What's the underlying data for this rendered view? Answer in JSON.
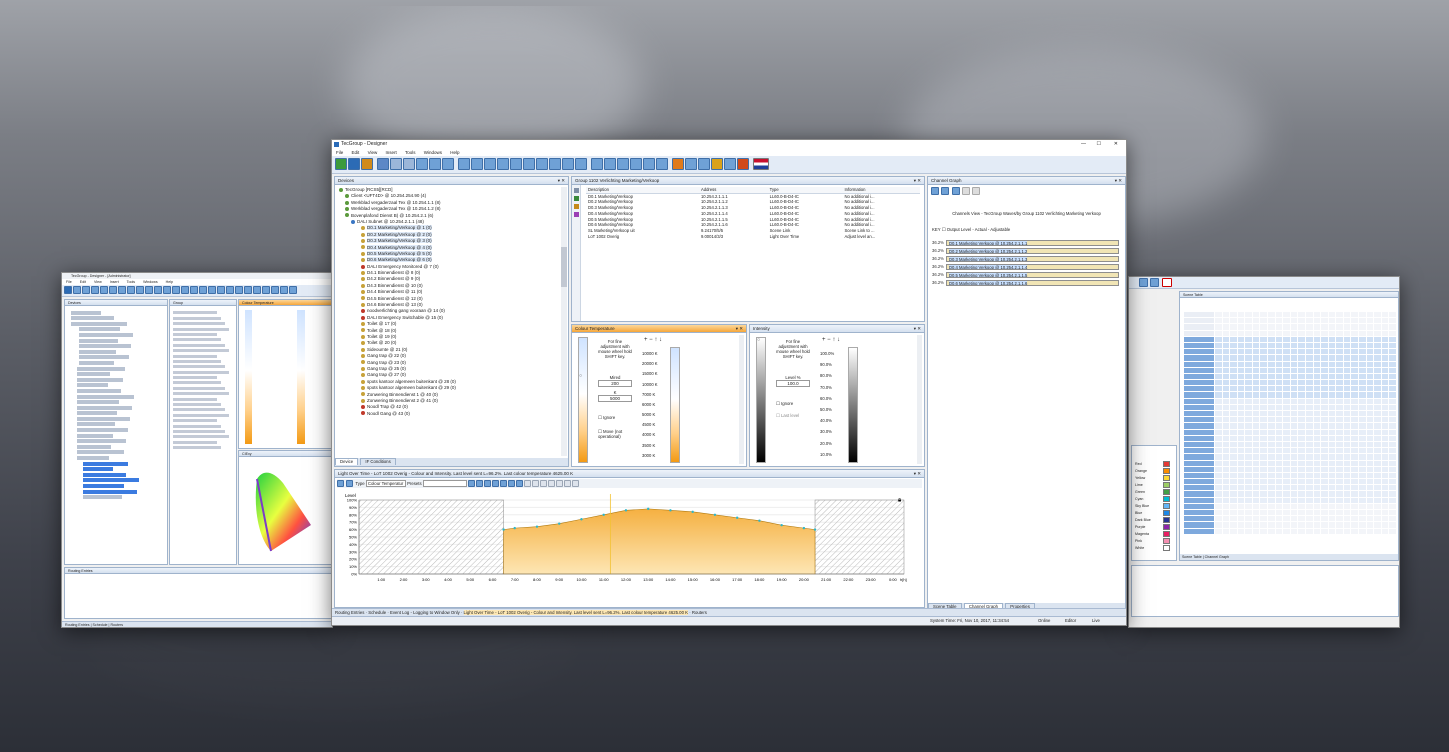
{
  "designer": {
    "title": "TecGroup - Designer",
    "menu": [
      "File",
      "Edit",
      "View",
      "Insert",
      "Tools",
      "Windows",
      "Help"
    ],
    "window_controls": [
      "—",
      "☐",
      "✕"
    ],
    "devices_panel": {
      "title": "Devices",
      "tree": [
        "TecGroup [RCS5][RCD]",
        "Client <UFT4D> @ 10.254.254.90 (4)",
        "Werkblad vergaderzaal Tex @ 10.254.1.1 (8)",
        "Werkblad vergaderzaal Tex @ 10.254.1.2 (8)",
        "Bovenplafond Dienst B) @ 10.254.2.1 (6)",
        "DALI Subnet @ 10.254.2.1.1 (48)",
        "D0.1 Marketing/Verkoop @ 1 (0)",
        "D0.2 Marketing/Verkoop @ 2 (0)",
        "D0.3 Marketing/Verkoop @ 3 (0)",
        "D0.4 Marketing/Verkoop @ 4 (0)",
        "D0.5 Marketing/Verkoop @ 5 (0)",
        "D0.6 Marketing/Verkoop @ 6 (0)",
        "DALI Emergency Monitored @ 7 (0)",
        "D4.1 Binnendienst @ 8 (0)",
        "D4.2 Binnendienst @ 9 (0)",
        "D4.3 Binnendienst @ 10 (0)",
        "D4.4 Binnendienst @ 11 (0)",
        "D4.5 Binnendienst @ 12 (0)",
        "D4.6 Binnendienst @ 13 (0)",
        "noodverlichting gang vooraan @ 14 (0)",
        "DALI Emergency Switchable @ 15 (0)",
        "Toilet @ 17 (0)",
        "Toilet @ 18 (0)",
        "Toilet @ 19 (0)",
        "Toilet @ 20 (0)",
        "Sideoumte @ 21 (0)",
        "Gang trap @ 22 (0)",
        "Gang trap @ 23 (0)",
        "Gang trap @ 25 (0)",
        "Gang trap @ 27 (0)",
        "spots kantoor algemeen buitenkant @ 28 (0)",
        "spots kantoor algemeen buitenkant @ 29 (0)",
        "Zonwering Binnendienst 1 @ 40 (0)",
        "Zonwering Binnendienst 2 @ 41 (0)",
        "Noodl Trap @ 42 (0)",
        "Noodl Gang @ 43 (0)"
      ],
      "tabs": [
        "Device",
        "IF Conditions"
      ]
    },
    "group_panel": {
      "title": "Group 1102 Verlichting Marketing/Verkoop",
      "columns": [
        "Description",
        "Address",
        "Type",
        "Information"
      ],
      "rows": [
        [
          "D0.1 Marketing/Verkoop",
          "10.254.2.1.1.1",
          "LL60.0-B-D4-IC",
          "No additional i..."
        ],
        [
          "D0.2 Marketing/Verkoop",
          "10.254.2.1.1.2",
          "LL60.0-B-D4-IC",
          "No additional i..."
        ],
        [
          "D0.3 Marketing/Verkoop",
          "10.254.2.1.1.3",
          "LL60.0-B-D4-IC",
          "No additional i..."
        ],
        [
          "D0.4 Marketing/Verkoop",
          "10.254.2.1.1.4",
          "LL60.0-B-D4-IC",
          "No additional i..."
        ],
        [
          "D0.5 Marketing/Verkoop",
          "10.254.2.1.1.5",
          "LL60.0-B-D4-IC",
          "No additional i..."
        ],
        [
          "D0.6 Marketing/Verkoop",
          "10.254.2.1.1.6",
          "LL60.0-B-D4-IC",
          "No additional i..."
        ],
        [
          "SL Marketing/Verkoop uit",
          "9.24170/5/5",
          "Scene Link",
          "Scene Link to ..."
        ],
        [
          "LoT 1002 Overig",
          "9.00014/3/3",
          "Light Over Time",
          "Adjust level an..."
        ]
      ]
    },
    "colour_temp": {
      "title": "Colour Temperature",
      "hint": "For fine adjustment with mouse wheel hold SHIFT key.",
      "mired_label": "Mired",
      "mired_value": "200",
      "k_label": "K",
      "k_value": "5000",
      "ignore_label": "Ignore",
      "move_label": "Move (not operational)",
      "scale": [
        "10000 K",
        "20000 K",
        "15000 K",
        "10000 K",
        "7000 K",
        "6000 K",
        "5000 K",
        "4500 K",
        "4000 K",
        "3500 K",
        "3000 K"
      ]
    },
    "intensity": {
      "title": "Intensity",
      "hint": "For fine adjustment with mouse wheel hold SHIFT key.",
      "level_label": "Level %",
      "level_value": "100.0",
      "ignore_label": "Ignore",
      "lastlevel_label": "Last level",
      "scale": [
        "100.0%",
        "90.0%",
        "80.0%",
        "70.0%",
        "60.0%",
        "50.0%",
        "40.0%",
        "30.0%",
        "20.0%",
        "10.0%"
      ]
    },
    "channel_graph": {
      "title": "Channel Graph",
      "caption": "Channels View - TecGroup Waves/by Group 1102 Verlichting Marketing Verkoop",
      "legend": "Output Level - Actual - Adjustable",
      "rows": [
        [
          "36.2%",
          "D0.1 Marketing Verkoop @ 10.254.2.1.1.1"
        ],
        [
          "36.2%",
          "D0.2 Marketing Verkoop @ 10.254.2.1.1.2"
        ],
        [
          "36.2%",
          "D0.3 Marketing Verkoop @ 10.254.2.1.1.3"
        ],
        [
          "36.2%",
          "D0.4 Marketing Verkoop @ 10.254.2.1.1.4"
        ],
        [
          "36.2%",
          "D0.5 Marketing Verkoop @ 10.254.2.1.1.5"
        ],
        [
          "36.2%",
          "D0.6 Marketing Verkoop @ 10.254.2.1.1.6"
        ]
      ],
      "tabs": [
        "Scene Table",
        "Channel Graph",
        "Properties"
      ]
    },
    "lot": {
      "title": "Light Over Time - LoT 1002 Overig - Colour and Intensity. Last level sent L=96.2%. Last colour temperature 4625.00 K",
      "type_label": "Type",
      "type_value": "Colour Temperatur",
      "presets_label": "Presets",
      "y_axis_label": "Level",
      "y_ticks": [
        "100%",
        "90%",
        "80%",
        "70%",
        "60%",
        "50%",
        "40%",
        "30%",
        "20%",
        "10%",
        "0%"
      ],
      "x_ticks": [
        "1:00",
        "2:00",
        "3:00",
        "4:00",
        "5:00",
        "6:00",
        "7:00",
        "8:00",
        "9:00",
        "10:00",
        "11:00",
        "12:00",
        "13:00",
        "14:00",
        "15:00",
        "16:00",
        "17:00",
        "18:00",
        "19:00",
        "20:00",
        "21:00",
        "22:00",
        "23:00",
        "0:00"
      ],
      "x_unit": "h[h]"
    },
    "status_tabs": [
      "Routing Entries",
      "Schedule",
      "Event Log - Logging to Window Only",
      "Light Over Time - LoT 1002 Overig - Colour and Intensity. Last level sent L=96.2%. Last colour temperature 4625.00 K",
      "Routers"
    ],
    "status_right": [
      "System Time: Fri, Nov 10, 2017, 11:34:54",
      "Online",
      "Editor",
      "Live"
    ]
  },
  "left_window": {
    "title": "TecGroup - Designer - [Administrator]",
    "menu": [
      "File",
      "Edit",
      "View",
      "Insert",
      "Tools",
      "Windows",
      "Help"
    ],
    "panels": [
      "Devices",
      "Group",
      "Colour Temperature",
      "CIExy"
    ],
    "bottom": [
      "Routing Entries",
      "Schedule",
      "Routers"
    ]
  },
  "right_window": {
    "panel": "Scene Table",
    "colors": [
      "Red",
      "Orange",
      "Yellow",
      "Lime",
      "Green",
      "Cyan",
      "Sky Blue",
      "Blue",
      "Dark Blue",
      "Purple",
      "Magenta",
      "Pink",
      "White"
    ],
    "tabs": [
      "Scene Table",
      "Channel Graph"
    ]
  }
}
